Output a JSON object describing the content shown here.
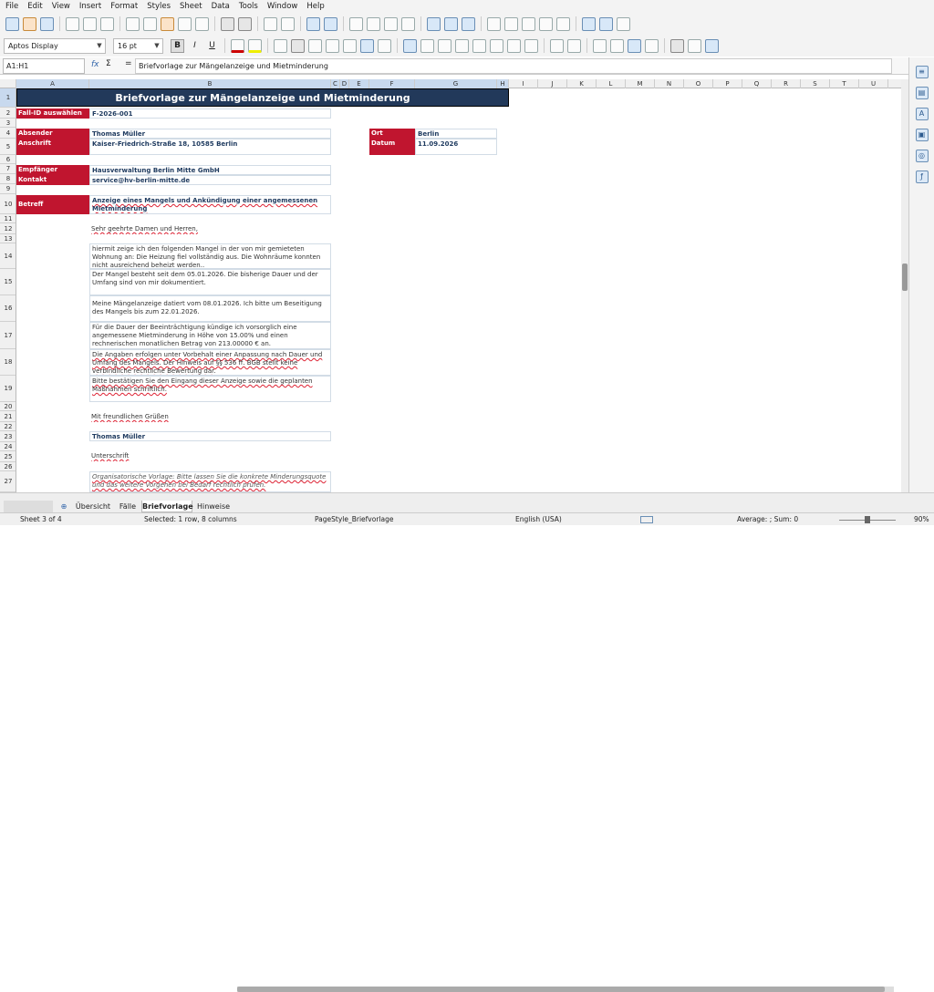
{
  "menu": [
    "File",
    "Edit",
    "View",
    "Insert",
    "Format",
    "Styles",
    "Sheet",
    "Data",
    "Tools",
    "Window",
    "Help"
  ],
  "format": {
    "font_name": "Aptos Display",
    "font_size": "16 pt",
    "bold": "B",
    "italic": "I",
    "underline": "U"
  },
  "formula": {
    "name_box": "A1:H1",
    "fx": "fx",
    "sum": "Σ",
    "eq": "=",
    "content": "Briefvorlage zur Mängelanzeige und Mietminderung"
  },
  "columns": [
    "A",
    "B",
    "C",
    "D",
    "E",
    "F",
    "G",
    "H",
    "I",
    "J",
    "K",
    "L",
    "M",
    "N",
    "O",
    "P",
    "Q",
    "R",
    "S",
    "T",
    "U"
  ],
  "rows": [
    "1",
    "2",
    "3",
    "4",
    "5",
    "6",
    "7",
    "8",
    "9",
    "10",
    "11",
    "12",
    "13",
    "14",
    "15",
    "16",
    "17",
    "18",
    "19",
    "20",
    "21",
    "22",
    "23",
    "24",
    "25",
    "26",
    "27"
  ],
  "sheet": {
    "title": "Briefvorlage zur Mängelanzeige und Mietminderung",
    "fall_label": "Fall-ID auswählen",
    "fall_value": "F-2026-001",
    "absender_label": "Absender",
    "absender_value": "Thomas Müller",
    "anschrift_label": "Anschrift",
    "anschrift_value": "Kaiser-Friedrich-Straße 18, 10585 Berlin",
    "ort_label": "Ort",
    "ort_value": "Berlin",
    "datum_label": "Datum",
    "datum_value": "11.09.2026",
    "empfaenger_label": "Empfänger",
    "empfaenger_value": "Hausverwaltung Berlin Mitte GmbH",
    "kontakt_label": "Kontakt",
    "kontakt_value": "service@hv-berlin-mitte.de",
    "betreff_label": "Betreff",
    "betreff_value": "Anzeige eines Mangels und Ankündigung einer angemessenen Mietminderung",
    "anrede": "Sehr geehrte Damen und Herren,",
    "p14": "hiermit zeige ich den folgenden Mangel in der von mir gemieteten Wohnung an: Die Heizung fiel vollständig aus. Die Wohnräume konnten nicht ausreichend beheizt werden..",
    "p15": "Der Mangel besteht seit dem 05.01.2026. Die bisherige Dauer und der Umfang sind von mir dokumentiert.",
    "p16": "Meine Mängelanzeige datiert vom 08.01.2026. Ich bitte um Beseitigung des Mangels bis zum 22.01.2026.",
    "p17": "Für die Dauer der Beeinträchtigung kündige ich vorsorglich eine angemessene Mietminderung in Höhe von 15.00% und einen rechnerischen monatlichen Betrag von 213.00000 € an.",
    "p18": "Die Angaben erfolgen unter Vorbehalt einer Anpassung nach Dauer und Umfang des Mangels. Der Hinweis auf §§ 536 ff. BGB stellt keine verbindliche rechtliche Bewertung dar.",
    "p19": "Bitte bestätigen Sie den Eingang dieser Anzeige sowie die geplanten Maßnahmen schriftlich.",
    "gruss": "Mit freundlichen Grüßen",
    "name": "Thomas Müller",
    "unterschrift": "Unterschrift",
    "hinweis": "Organisatorische Vorlage: Bitte lassen Sie die konkrete Minderungsquote und das weitere Vorgehen bei Bedarf rechtlich prüfen."
  },
  "tabs": [
    "Übersicht",
    "Fälle",
    "Briefvorlage",
    "Hinweise"
  ],
  "status": {
    "sheet": "Sheet 3 of 4",
    "selected": "Selected: 1 row, 8 columns",
    "pagestyle": "PageStyle_Briefvorlage",
    "language": "English (USA)",
    "average": "Average: ; Sum: 0",
    "zoom": "90%"
  }
}
